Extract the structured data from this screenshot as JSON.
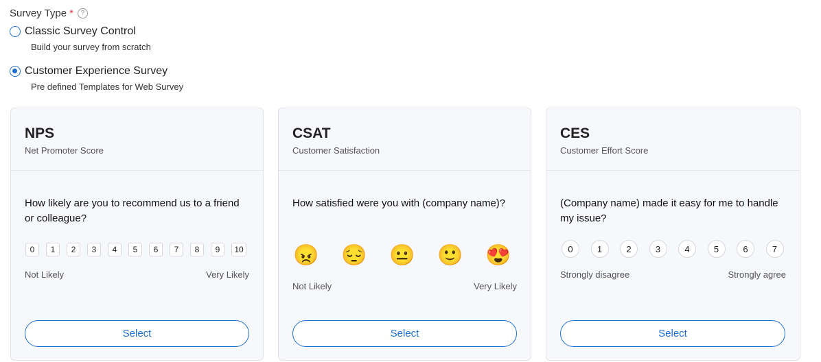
{
  "field": {
    "label": "Survey Type",
    "required_mark": "*",
    "help_icon": "?"
  },
  "options": [
    {
      "label": "Classic Survey Control",
      "description": "Build your survey from scratch",
      "checked": false
    },
    {
      "label": "Customer Experience Survey",
      "description": "Pre defined Templates for Web Survey",
      "checked": true
    }
  ],
  "cards": {
    "nps": {
      "title": "NPS",
      "subtitle": "Net Promoter Score",
      "question": "How likely are you to recommend us to a friend or colleague?",
      "scale": [
        "0",
        "1",
        "2",
        "3",
        "4",
        "5",
        "6",
        "7",
        "8",
        "9",
        "10"
      ],
      "low_label": "Not Likely",
      "high_label": "Very Likely",
      "button": "Select"
    },
    "csat": {
      "title": "CSAT",
      "subtitle": "Customer Satisfaction",
      "question": "How satisfied were you with (company name)?",
      "emojis": [
        "😠",
        "😔",
        "😐",
        "🙂",
        "😍"
      ],
      "low_label": "Not Likely",
      "high_label": "Very Likely",
      "button": "Select"
    },
    "ces": {
      "title": "CES",
      "subtitle": "Customer Effort Score",
      "question": "(Company name) made it easy for me to handle my issue?",
      "scale": [
        "0",
        "1",
        "2",
        "3",
        "4",
        "5",
        "6",
        "7"
      ],
      "low_label": "Strongly disagree",
      "high_label": "Strongly agree",
      "button": "Select"
    }
  },
  "colors": {
    "accent": "#1f6fd1",
    "required": "#e0334b",
    "card_bg": "#f7f8fb"
  }
}
